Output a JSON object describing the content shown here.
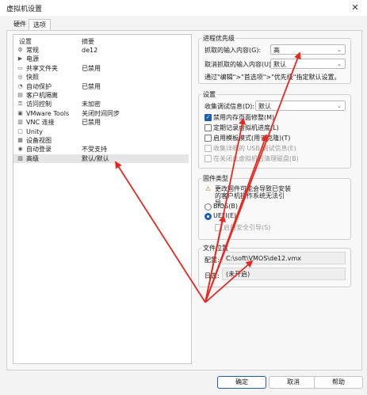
{
  "window": {
    "title": "虚拟机设置",
    "close_glyph": "✕"
  },
  "tabs": [
    {
      "label": "硬件"
    },
    {
      "label": "选项"
    }
  ],
  "devices": {
    "col_setting": "设置",
    "col_summary": "摘要",
    "items": [
      {
        "icon": "gear-icon",
        "glyph": "⚙",
        "name": "常规",
        "summary": "de12"
      },
      {
        "icon": "power-icon",
        "glyph": "▶",
        "name": "电源",
        "summary": ""
      },
      {
        "icon": "shared-folder-icon",
        "glyph": "▭",
        "name": "共享文件夹",
        "summary": "已禁用"
      },
      {
        "icon": "snapshot-icon",
        "glyph": "◎",
        "name": "快照",
        "summary": ""
      },
      {
        "icon": "autoprotect-icon",
        "glyph": "◔",
        "name": "自动保护",
        "summary": "已禁用"
      },
      {
        "icon": "isolation-icon",
        "glyph": "▤",
        "name": "客户机隔离",
        "summary": ""
      },
      {
        "icon": "access-control-icon",
        "glyph": "⚿",
        "name": "访问控制",
        "summary": "未加密"
      },
      {
        "icon": "vmware-tools-icon",
        "glyph": "▣",
        "name": "VMware Tools",
        "summary": "关闭时间同步"
      },
      {
        "icon": "vnc-icon",
        "glyph": "▥",
        "name": "VNC 连接",
        "summary": "已禁用"
      },
      {
        "icon": "unity-icon",
        "glyph": "▢",
        "name": "Unity",
        "summary": ""
      },
      {
        "icon": "appliance-view-icon",
        "glyph": "▦",
        "name": "设备视图",
        "summary": ""
      },
      {
        "icon": "autologin-icon",
        "glyph": "◉",
        "name": "自动登录",
        "summary": "不受支持"
      },
      {
        "icon": "advanced-icon",
        "glyph": "▧",
        "name": "高级",
        "summary": "默认/默认"
      }
    ]
  },
  "process_priority": {
    "title": "进程优先级",
    "grabbed_label": "抓取的输入内容(G):",
    "grabbed_value": "高",
    "ungrabbed_label": "取消抓取的输入内容(U):",
    "ungrabbed_value": "默认",
    "hint": "通过\"编辑\">\"首选项\">\"优先级\"指定默认设置。"
  },
  "settings": {
    "title": "设置",
    "debug_label": "收集调试信息(D):",
    "debug_value": "默认",
    "options": [
      {
        "label": "禁用内存页面修整(M)",
        "checked": true,
        "disabled": false
      },
      {
        "label": "定期记录虚拟机进度(L)",
        "checked": false,
        "disabled": false
      },
      {
        "label": "启用模板模式(用于克隆)(T)",
        "checked": false,
        "disabled": false
      },
      {
        "label": "收集详细的 USB 调试信息(E)",
        "checked": false,
        "disabled": true
      },
      {
        "label": "在关闭此虚拟机后清理磁盘(B)",
        "checked": false,
        "disabled": true
      }
    ]
  },
  "firmware": {
    "title": "固件类型",
    "warning": "更改固件可能会导致已安装的客户机操作系统无法引导。",
    "warning_glyph": "⚠",
    "bios_label": "BIOS(B)",
    "uefi_label": "UEFI(E)",
    "uefi_selected": true,
    "secure_boot_label": "启用安全引导(S)",
    "secure_boot_checked": false
  },
  "file_location": {
    "title": "文件位置",
    "config_label": "配置:",
    "config_value": "C:\\soft\\VMOS\\de12.vmx",
    "log_label": "日志:",
    "log_value": "(未开启)"
  },
  "buttons": {
    "ok": "确定",
    "cancel": "取消",
    "help": "帮助"
  },
  "annotation_color": "#e8281e"
}
